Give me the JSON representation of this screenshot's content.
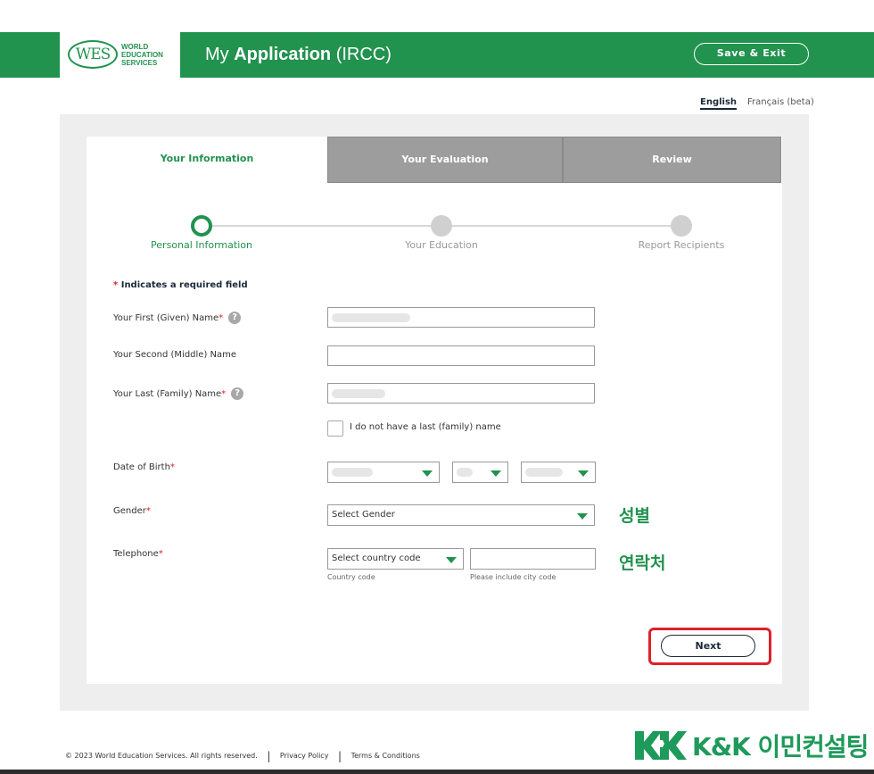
{
  "header": {
    "logo_mark": "WES",
    "logo_lines": [
      "WORLD",
      "EDUCATION",
      "SERVICES"
    ],
    "title_prefix": "My",
    "title_bold": "Application",
    "title_suffix": "(IRCC)",
    "save_exit_label": "Save & Exit"
  },
  "language": {
    "english": "English",
    "french": "Français (beta)",
    "selected": "English"
  },
  "tabs": [
    {
      "label": "Your Information",
      "active": true
    },
    {
      "label": "Your Evaluation",
      "active": false
    },
    {
      "label": "Review",
      "active": false
    }
  ],
  "steps": [
    {
      "label": "Personal Information",
      "active": true
    },
    {
      "label": "Your Education",
      "active": false
    },
    {
      "label": "Report Recipients",
      "active": false
    }
  ],
  "form": {
    "required_note": "Indicates a required field",
    "required_star": "*",
    "first_name_label": "Your First (Given) Name",
    "middle_name_label": "Your Second (Middle) Name",
    "last_name_label": "Your Last (Family) Name",
    "no_last_name_label": "I do not have a last (family) name",
    "dob_label": "Date of Birth",
    "gender_label": "Gender",
    "gender_placeholder": "Select Gender",
    "telephone_label": "Telephone",
    "country_code_placeholder": "Select country code",
    "country_code_hint": "Country code",
    "city_code_hint": "Please include city code",
    "help_glyph": "?"
  },
  "annotations": {
    "gender_ko": "성별",
    "telephone_ko": "연락처"
  },
  "next_label": "Next",
  "footer": {
    "copyright": "© 2023 World Education Services. All rights reserved.",
    "privacy": "Privacy Policy",
    "terms": "Terms & Conditions"
  },
  "watermark": {
    "text": "K&K 이민컨설팅"
  },
  "colors": {
    "brand_green": "#22924f",
    "highlight_red": "#e0202a",
    "tab_gray": "#9d9d9d"
  }
}
